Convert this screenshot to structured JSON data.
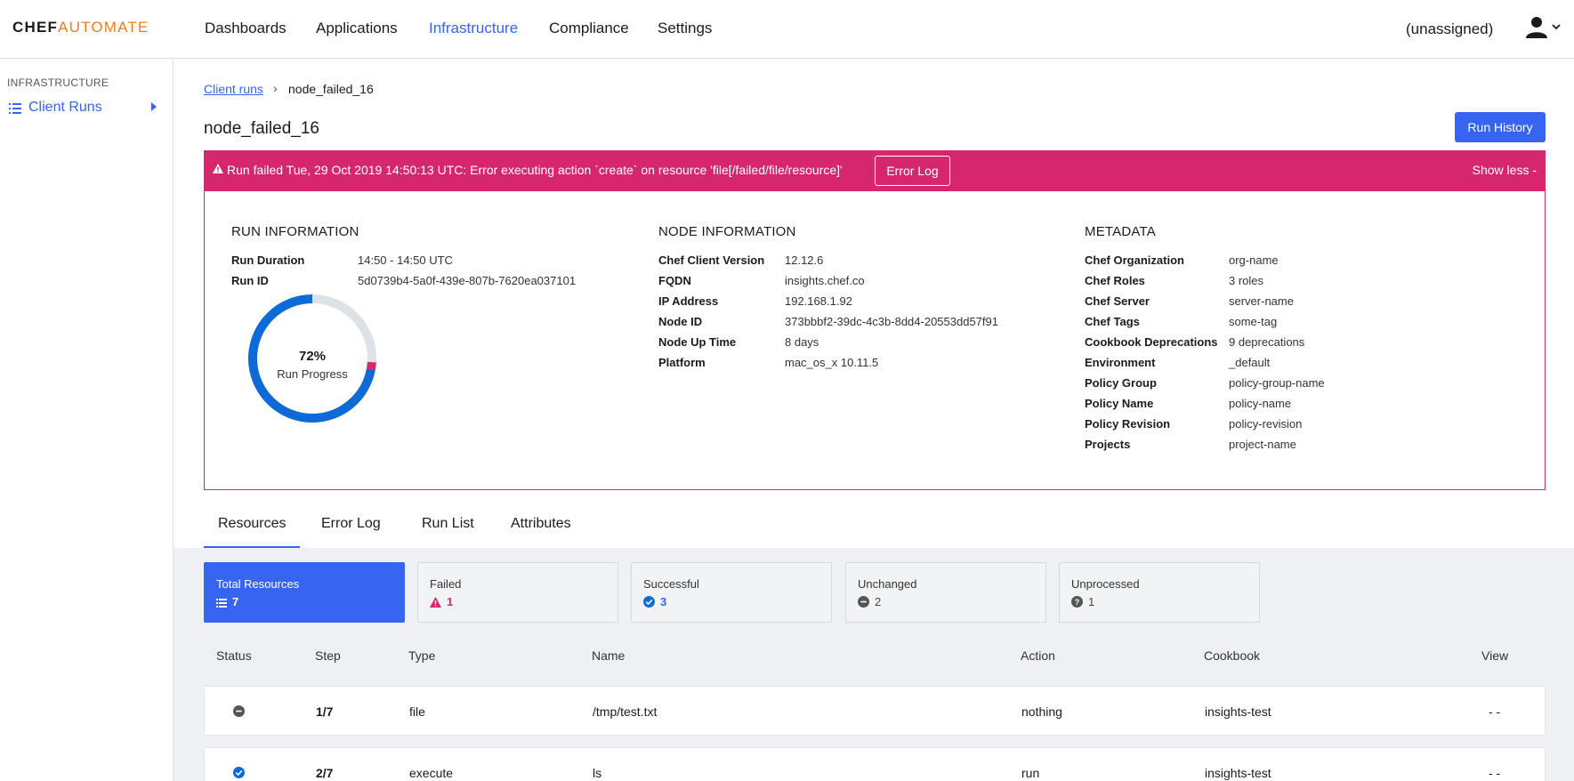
{
  "brand": {
    "chef": "CHEF",
    "automate": "AUTOMATE"
  },
  "nav": {
    "items": [
      {
        "label": "Dashboards",
        "active": false
      },
      {
        "label": "Applications",
        "active": false
      },
      {
        "label": "Infrastructure",
        "active": true
      },
      {
        "label": "Compliance",
        "active": false
      },
      {
        "label": "Settings",
        "active": false
      }
    ],
    "project": "(unassigned)"
  },
  "sidebar": {
    "heading": "INFRASTRUCTURE",
    "items": [
      {
        "label": "Client Runs",
        "icon": "list-icon"
      }
    ]
  },
  "breadcrumb": {
    "parent": "Client runs",
    "current": "node_failed_16"
  },
  "page": {
    "title": "node_failed_16",
    "run_history_label": "Run History"
  },
  "banner": {
    "message": "Run failed Tue, 29 Oct 2019 14:50:13 UTC: Error executing action `create` on resource 'file[/failed/file/resource]'",
    "error_log_label": "Error Log",
    "show_less_label": "Show less -",
    "color": "#d6276e"
  },
  "run_info": {
    "title": "RUN INFORMATION",
    "fields": [
      {
        "label": "Run Duration",
        "value": "14:50 - 14:50 UTC"
      },
      {
        "label": "Run ID",
        "value": "5d0739b4-5a0f-439e-807b-7620ea037101"
      }
    ],
    "progress": {
      "percent_label": "72%",
      "label": "Run Progress",
      "success": 0.72,
      "failed": 0.02
    }
  },
  "node_info": {
    "title": "NODE INFORMATION",
    "fields": [
      {
        "label": "Chef Client Version",
        "value": "12.12.6"
      },
      {
        "label": "FQDN",
        "value": "insights.chef.co"
      },
      {
        "label": "IP Address",
        "value": "192.168.1.92"
      },
      {
        "label": "Node ID",
        "value": "373bbbf2-39dc-4c3b-8dd4-20553dd57f91"
      },
      {
        "label": "Node Up Time",
        "value": "8 days"
      },
      {
        "label": "Platform",
        "value": "mac_os_x 10.11.5"
      }
    ]
  },
  "metadata": {
    "title": "METADATA",
    "fields": [
      {
        "label": "Chef Organization",
        "value": "org-name"
      },
      {
        "label": "Chef Roles",
        "value": "3 roles"
      },
      {
        "label": "Chef Server",
        "value": "server-name"
      },
      {
        "label": "Chef Tags",
        "value": "some-tag"
      },
      {
        "label": "Cookbook Deprecations",
        "value": "9 deprecations"
      },
      {
        "label": "Environment",
        "value": "_default"
      },
      {
        "label": "Policy Group",
        "value": "policy-group-name"
      },
      {
        "label": "Policy Name",
        "value": "policy-name"
      },
      {
        "label": "Policy Revision",
        "value": "policy-revision"
      },
      {
        "label": "Projects",
        "value": "project-name"
      }
    ]
  },
  "tabs": [
    {
      "label": "Resources",
      "active": true
    },
    {
      "label": "Error Log",
      "active": false
    },
    {
      "label": "Run List",
      "active": false
    },
    {
      "label": "Attributes",
      "active": false
    }
  ],
  "stats": [
    {
      "label": "Total Resources",
      "value": "7",
      "icon": "list-icon",
      "active": true
    },
    {
      "label": "Failed",
      "value": "1",
      "icon": "warning-icon",
      "color": "#d6276e"
    },
    {
      "label": "Successful",
      "value": "3",
      "icon": "check-circle-icon",
      "color": "#3864f2"
    },
    {
      "label": "Unchanged",
      "value": "2",
      "icon": "minus-circle-icon",
      "color": "#555555"
    },
    {
      "label": "Unprocessed",
      "value": "1",
      "icon": "question-circle-icon",
      "color": "#555555"
    }
  ],
  "table": {
    "headers": [
      "Status",
      "Step",
      "Type",
      "Name",
      "Action",
      "Cookbook",
      "View"
    ],
    "rows": [
      {
        "status": "unchanged",
        "step": "1/7",
        "type": "file",
        "name": "/tmp/test.txt",
        "action": "nothing",
        "cookbook": "insights-test",
        "view": "- -"
      },
      {
        "status": "successful",
        "step": "2/7",
        "type": "execute",
        "name": "ls",
        "action": "run",
        "cookbook": "insights-test",
        "view": "- -"
      }
    ]
  }
}
